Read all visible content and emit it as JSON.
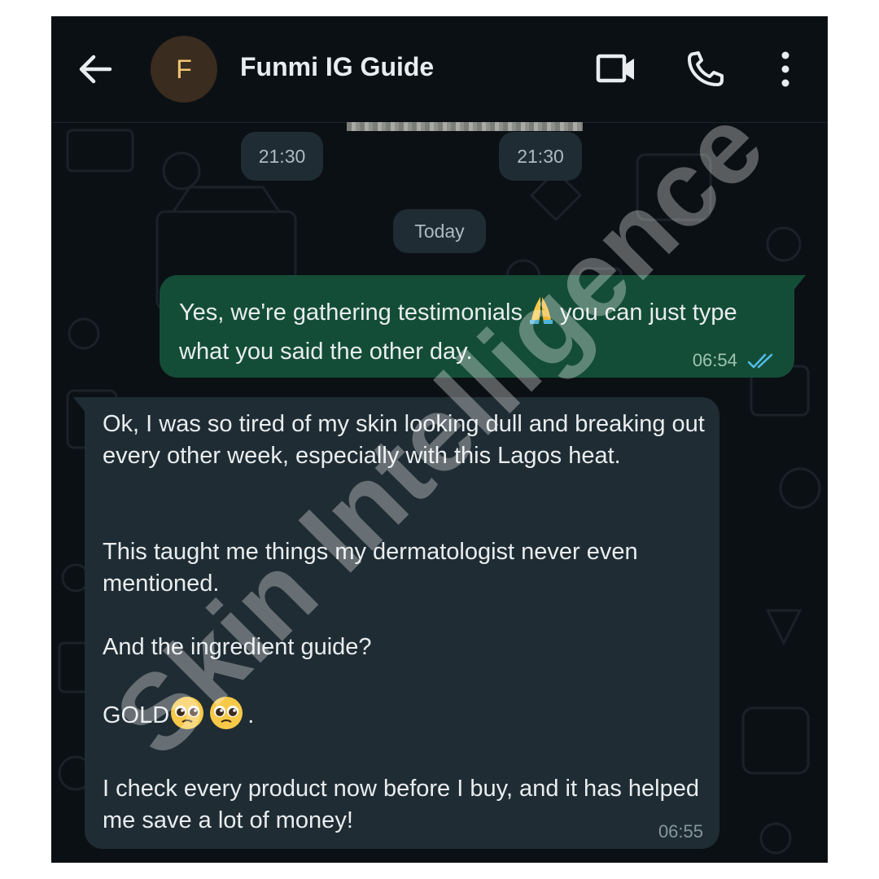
{
  "header": {
    "avatar_letter": "F",
    "contact_name": "Funmi IG Guide",
    "back_icon": "arrow-left-icon",
    "video_icon": "video-camera-icon",
    "call_icon": "phone-icon",
    "menu_icon": "more-vertical-icon"
  },
  "earlier": {
    "time_left": "21:30",
    "time_right": "21:30"
  },
  "date_separator": "Today",
  "outgoing": {
    "text_before_emoji": "Yes, we're gathering testimonials",
    "emoji": "folded-hands-emoji",
    "text_after_emoji": "you can just type what you said the other day.",
    "time": "06:54",
    "status_icon": "double-check-read-icon"
  },
  "incoming": {
    "para1": "Ok, I was so tired of my skin looking dull and breaking out every other week, especially with this Lagos heat.",
    "para2": "This taught me things my dermatologist never even mentioned.",
    "para3": "And the ingredient guide?",
    "para4_text": "GOLD",
    "para4_emoji": "pleading-face-emoji",
    "para4_suffix": ".",
    "para5": "I check every product now before I buy, and it has helped me save a lot of money!",
    "time": "06:55"
  },
  "watermark": "Skin Intelligence",
  "colors": {
    "background": "#0b1014",
    "outgoing_bubble": "#144d37",
    "incoming_bubble": "#1f2c33",
    "read_ticks": "#53bdeb",
    "avatar_letter": "#f2c572"
  }
}
